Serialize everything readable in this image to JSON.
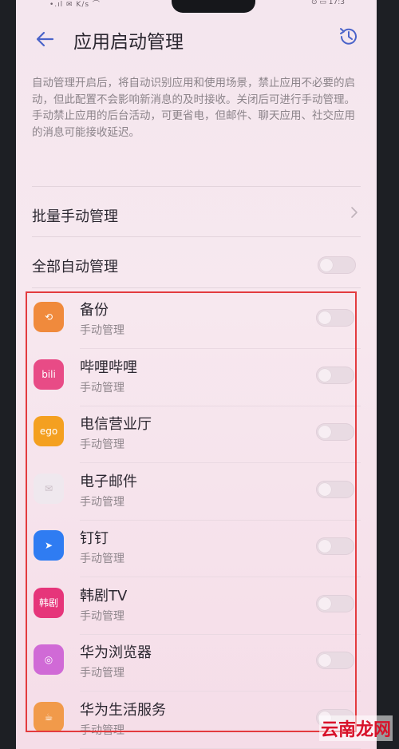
{
  "status_bar": {
    "left": "•.ıl ✉ K/s ⌒",
    "right": "⊙ ▭ 17:3"
  },
  "header": {
    "title": "应用启动管理"
  },
  "description": {
    "para1": "自动管理开启后，将自动识别应用和使用场景，禁止应用不必要的启动，但此配置不会影响新消息的及时接收。关闭后可进行手动管理。",
    "para2": "手动禁止应用的后台活动，可更省电，但邮件、聊天应用、社交应用的消息可能接收延迟。"
  },
  "batch_manual": {
    "label": "批量手动管理"
  },
  "all_auto": {
    "label": "全部自动管理",
    "enabled": false
  },
  "apps": [
    {
      "name": "备份",
      "status": "手动管理",
      "icon": "backup-icon",
      "color": "#f08a3c",
      "glyph": "⟲"
    },
    {
      "name": "哔哩哔哩",
      "status": "手动管理",
      "icon": "bilibili-icon",
      "color": "#e84b86",
      "glyph": "bili"
    },
    {
      "name": "电信营业厅",
      "status": "手动管理",
      "icon": "telecom-icon",
      "color": "#f4a020",
      "glyph": "ego"
    },
    {
      "name": "电子邮件",
      "status": "手动管理",
      "icon": "mail-icon",
      "color": "#efe8ee",
      "glyph": "✉"
    },
    {
      "name": "钉钉",
      "status": "手动管理",
      "icon": "dingtalk-icon",
      "color": "#2f7cf2",
      "glyph": "➤"
    },
    {
      "name": "韩剧TV",
      "status": "手动管理",
      "icon": "hanjutv-icon",
      "color": "#e6357a",
      "glyph": "韩剧"
    },
    {
      "name": "华为浏览器",
      "status": "手动管理",
      "icon": "browser-icon",
      "color": "#d06ad6",
      "glyph": "◎"
    },
    {
      "name": "华为生活服务",
      "status": "手动管理",
      "icon": "life-service-icon",
      "color": "#f19a4a",
      "glyph": "☕"
    }
  ],
  "watermark": "云南龙网"
}
